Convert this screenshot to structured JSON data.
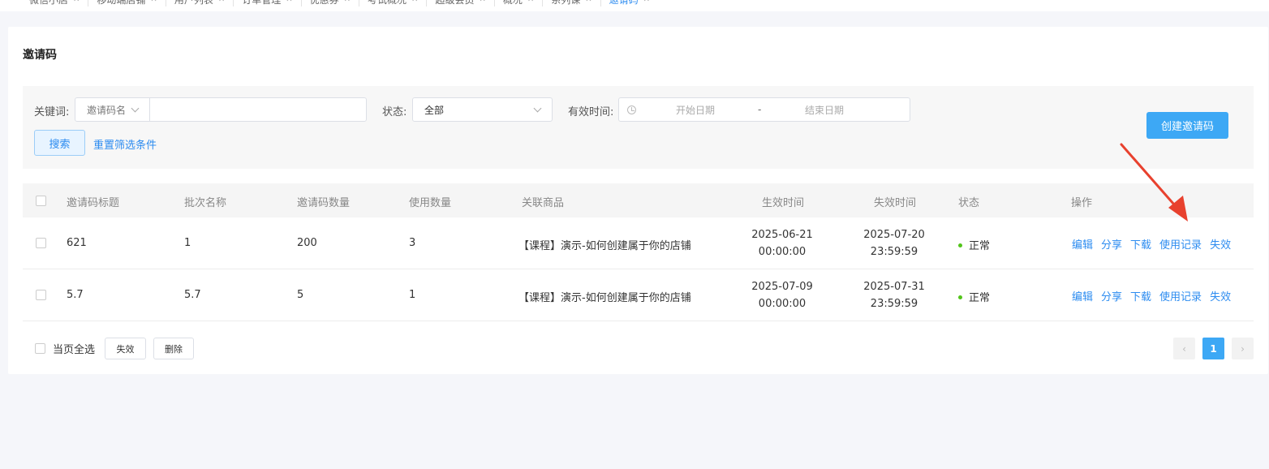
{
  "breadcrumbs": [
    {
      "label": "微信小店",
      "active": false
    },
    {
      "label": "移动端店铺",
      "active": false
    },
    {
      "label": "用户列表",
      "active": false
    },
    {
      "label": "订单管理",
      "active": false
    },
    {
      "label": "优惠券",
      "active": false
    },
    {
      "label": "考试概况",
      "active": false
    },
    {
      "label": "超级会员",
      "active": false
    },
    {
      "label": "概况",
      "active": false
    },
    {
      "label": "系列课",
      "active": false
    },
    {
      "label": "邀请码",
      "active": true
    }
  ],
  "page_title": "邀请码",
  "filter": {
    "keyword_label": "关键词:",
    "keyword_type": "邀请码名",
    "keyword_value": "",
    "status_label": "状态:",
    "status_value": "全部",
    "time_label": "有效时间:",
    "start_placeholder": "开始日期",
    "separator": "-",
    "end_placeholder": "结束日期",
    "search_label": "搜索",
    "reset_label": "重置筛选条件",
    "create_label": "创建邀请码"
  },
  "table": {
    "headers": {
      "title": "邀请码标题",
      "batch": "批次名称",
      "count": "邀请码数量",
      "used": "使用数量",
      "product": "关联商品",
      "start": "生效时间",
      "end": "失效时间",
      "status": "状态",
      "ops": "操作"
    },
    "rows": [
      {
        "title": "621",
        "batch": "1",
        "count": "200",
        "used": "3",
        "product": "【课程】演示-如何创建属于你的店铺",
        "start_date": "2025-06-21",
        "start_time": "00:00:00",
        "end_date": "2025-07-20",
        "end_time": "23:59:59",
        "status": "正常",
        "ops": [
          "编辑",
          "分享",
          "下载",
          "使用记录",
          "失效"
        ]
      },
      {
        "title": "5.7",
        "batch": "5.7",
        "count": "5",
        "used": "1",
        "product": "【课程】演示-如何创建属于你的店铺",
        "start_date": "2025-07-09",
        "start_time": "00:00:00",
        "end_date": "2025-07-31",
        "end_time": "23:59:59",
        "status": "正常",
        "ops": [
          "编辑",
          "分享",
          "下载",
          "使用记录",
          "失效"
        ]
      }
    ]
  },
  "footer": {
    "select_all_label": "当页全选",
    "invalidate_label": "失效",
    "delete_label": "删除",
    "current_page": "1",
    "prev_label": "‹",
    "next_label": "›"
  },
  "colors": {
    "accent": "#2d8cf0",
    "primary_button": "#3da8f5",
    "status_ok": "#52c41a",
    "annotation_arrow": "#e8412e"
  }
}
